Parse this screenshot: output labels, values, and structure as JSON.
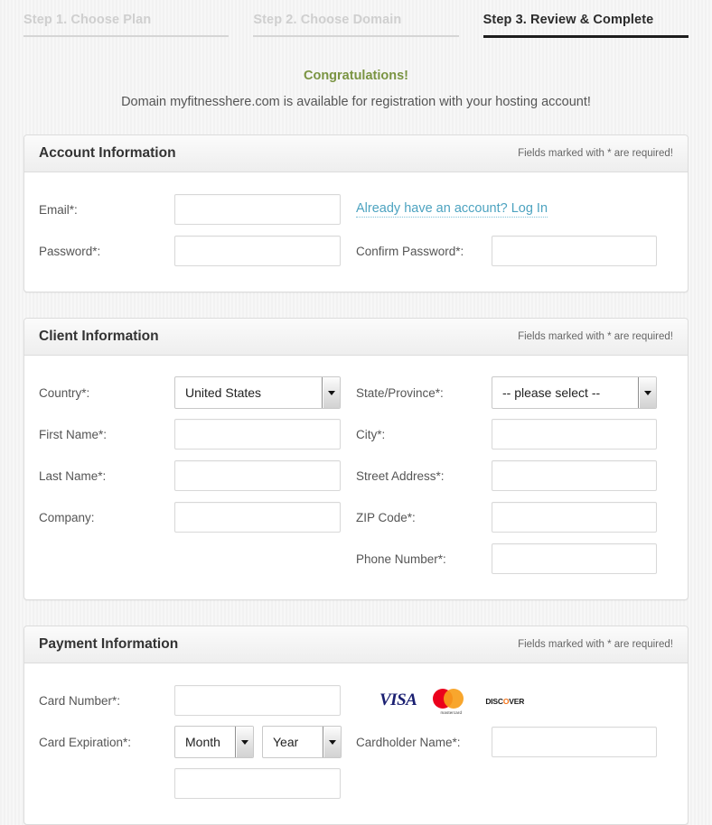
{
  "steps": [
    {
      "label": "Step 1. Choose Plan",
      "state": "inactive"
    },
    {
      "label": "Step 2. Choose Domain",
      "state": "inactive"
    },
    {
      "label": "Step 3. Review & Complete",
      "state": "active"
    }
  ],
  "notice": {
    "heading": "Congratulations!",
    "message": "Domain myfitnesshere.com is available for registration with your hosting account!",
    "heading_color": "#7a9442"
  },
  "required_note": "Fields marked with * are required!",
  "account": {
    "title": "Account Information",
    "email_label": "Email*:",
    "email_value": "",
    "login_link": "Already have an account? Log In",
    "password_label": "Password*:",
    "password_value": "",
    "confirm_label": "Confirm Password*:",
    "confirm_value": ""
  },
  "client": {
    "title": "Client Information",
    "country_label": "Country*:",
    "country_value": "United States",
    "state_label": "State/Province*:",
    "state_value": "-- please select --",
    "first_name_label": "First Name*:",
    "first_name_value": "",
    "city_label": "City*:",
    "city_value": "",
    "last_name_label": "Last Name*:",
    "last_name_value": "",
    "street_label": "Street Address*:",
    "street_value": "",
    "company_label": "Company:",
    "company_value": "",
    "zip_label": "ZIP Code*:",
    "zip_value": "",
    "phone_label": "Phone Number*:",
    "phone_value": ""
  },
  "payment": {
    "title": "Payment Information",
    "card_number_label": "Card Number*:",
    "card_number_value": "",
    "card_logos": [
      "VISA",
      "mastercard",
      "DISCOVER"
    ],
    "expiration_label": "Card Expiration*:",
    "month_value": "Month",
    "year_value": "Year",
    "cardholder_label": "Cardholder Name*:",
    "cardholder_value": ""
  },
  "colors": {
    "link": "#4da3c0",
    "accent_green": "#7a9442",
    "panel_border": "#dcdcdc"
  }
}
